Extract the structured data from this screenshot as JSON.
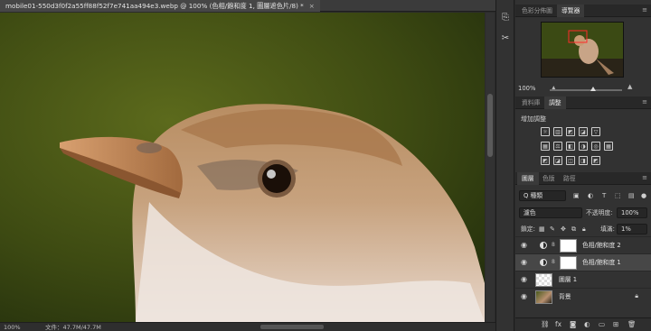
{
  "document": {
    "tab_title": "mobile01-550d3f0f2a55ff88f52f7e741aa494e3.webp @ 100% (色相/飽和度 1, 圖層遮色片/8) *",
    "close": "×"
  },
  "status": {
    "zoom": "100%",
    "doc_size": "文件：47.7M/47.7M"
  },
  "navigator": {
    "tabs": [
      "色彩分佈圖",
      "導覽器"
    ],
    "active_tab": 1,
    "zoom": "100%"
  },
  "adjustments": {
    "tabs": [
      "資料庫",
      "調整"
    ],
    "active_tab": 1,
    "title": "增加調整",
    "row1": [
      "☼",
      "▥",
      "◩",
      "◪",
      "▽"
    ],
    "row2": [
      "▦",
      "⚖",
      "◧",
      "◑",
      "◎",
      "▦"
    ],
    "row3": [
      "◩",
      "◪",
      "◫",
      "◨",
      "◩"
    ]
  },
  "layers": {
    "tabs": [
      "圖層",
      "色版",
      "路徑"
    ],
    "active_tab": 0,
    "filter_kind": "Q 種類",
    "blend_mode": "濾色",
    "opacity_label": "不透明度:",
    "opacity": "100%",
    "lock_label": "鎖定:",
    "fill_label": "填滿:",
    "fill": "1%",
    "items": [
      {
        "name": "色相/飽和度 2",
        "type": "adjustment",
        "selected": false
      },
      {
        "name": "色相/飽和度 1",
        "type": "adjustment",
        "selected": true
      },
      {
        "name": "圖層 1",
        "type": "pixel",
        "selected": false
      },
      {
        "name": "背景",
        "type": "background",
        "selected": false
      }
    ],
    "footer_icons": [
      "link-icon",
      "fx",
      "mask",
      "adjust",
      "folder",
      "new",
      "trash"
    ]
  }
}
